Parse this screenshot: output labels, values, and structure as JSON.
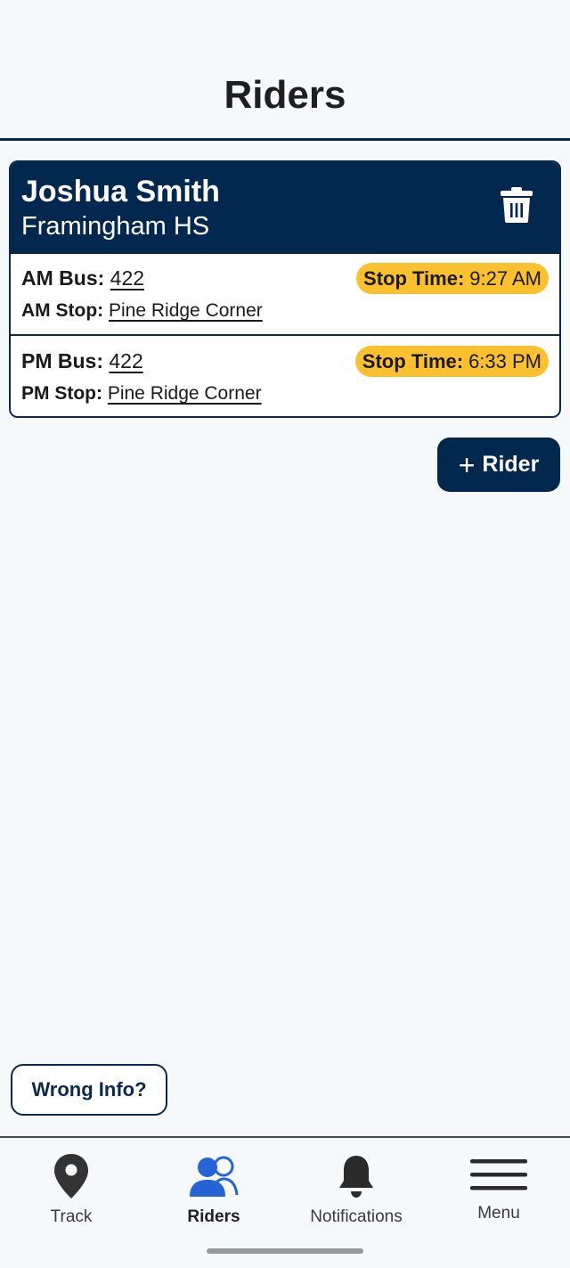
{
  "header": {
    "title": "Riders"
  },
  "rider": {
    "name": "Joshua Smith",
    "school": "Framingham HS",
    "am": {
      "bus_label": "AM Bus:",
      "bus": "422",
      "stop_label": "AM Stop:",
      "stop": "Pine Ridge Corner",
      "time_label": "Stop Time:",
      "time": "9:27 AM"
    },
    "pm": {
      "bus_label": "PM Bus:",
      "bus": "422",
      "stop_label": "PM Stop:",
      "stop": "Pine Ridge Corner",
      "time_label": "Stop Time:",
      "time": "6:33 PM"
    }
  },
  "actions": {
    "add_rider_label": "Rider",
    "wrong_info_label": "Wrong Info?"
  },
  "tabs": [
    {
      "label": "Track",
      "icon": "map-pin-icon"
    },
    {
      "label": "Riders",
      "icon": "riders-icon"
    },
    {
      "label": "Notifications",
      "icon": "bell-icon"
    },
    {
      "label": "Menu",
      "icon": "hamburger-icon"
    }
  ],
  "colors": {
    "navy": "#02284f",
    "accent_blue": "#1a5fd6",
    "pill_yellow": "#fbc02d",
    "background": "#f6f9fc"
  }
}
